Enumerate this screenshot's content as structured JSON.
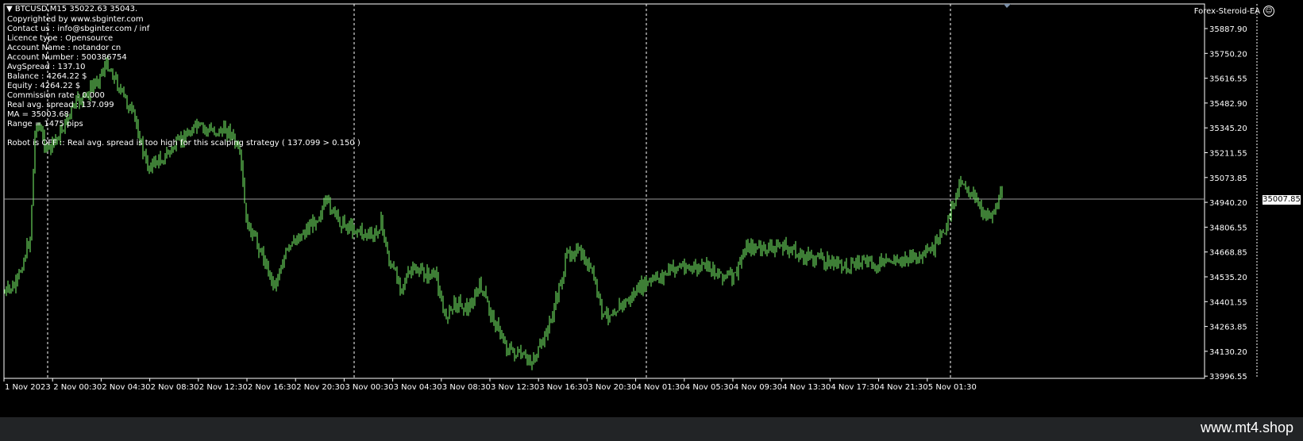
{
  "header": {
    "symbol_line": "BTCUSD,M15  35022.63 35043.",
    "ea_name": "Forex-Steroid-EA",
    "smiley": "☺"
  },
  "info_lines": [
    "Copyrighted by www.sbginter.com",
    "Contact us : info@sbginter.com / inf",
    "Licence type : Opensource",
    "Account Name : notandor cn",
    "Account Number : 500386754",
    "AvgSpread : 137.10",
    "Balance : 4264.22 $",
    "Equity : 4264.22 $",
    "Commission rate : 0.000",
    "Real avg. spread : 137.099",
    "MA = 35003.68",
    "Range = 1475 pips"
  ],
  "status_line": "Robot is OFF :: Real avg. spread is too high for this scalping strategy ( 137.099 > 0.150 )",
  "price_axis": {
    "ticks": [
      "35887.90",
      "35750.20",
      "35616.55",
      "35482.90",
      "35345.20",
      "35211.55",
      "35073.85",
      "34940.20",
      "34806.55",
      "34668.85",
      "34535.20",
      "34401.55",
      "34263.85",
      "34130.20",
      "33996.55"
    ],
    "current": "35007.85"
  },
  "time_axis": {
    "ticks": [
      "1 Nov 2023",
      "2 Nov 00:30",
      "2 Nov 04:30",
      "2 Nov 08:30",
      "2 Nov 12:30",
      "2 Nov 16:30",
      "2 Nov 20:30",
      "3 Nov 00:30",
      "3 Nov 04:30",
      "3 Nov 08:30",
      "3 Nov 12:30",
      "3 Nov 16:30",
      "3 Nov 20:30",
      "4 Nov 01:30",
      "4 Nov 05:30",
      "4 Nov 09:30",
      "4 Nov 13:30",
      "4 Nov 17:30",
      "4 Nov 21:30",
      "5 Nov 01:30"
    ]
  },
  "colors": {
    "background": "#000000",
    "candles": "#7CFC6B",
    "grid": "#ffffff",
    "footer": "#222426"
  },
  "footer": {
    "watermark": "www.mt4.shop"
  }
}
